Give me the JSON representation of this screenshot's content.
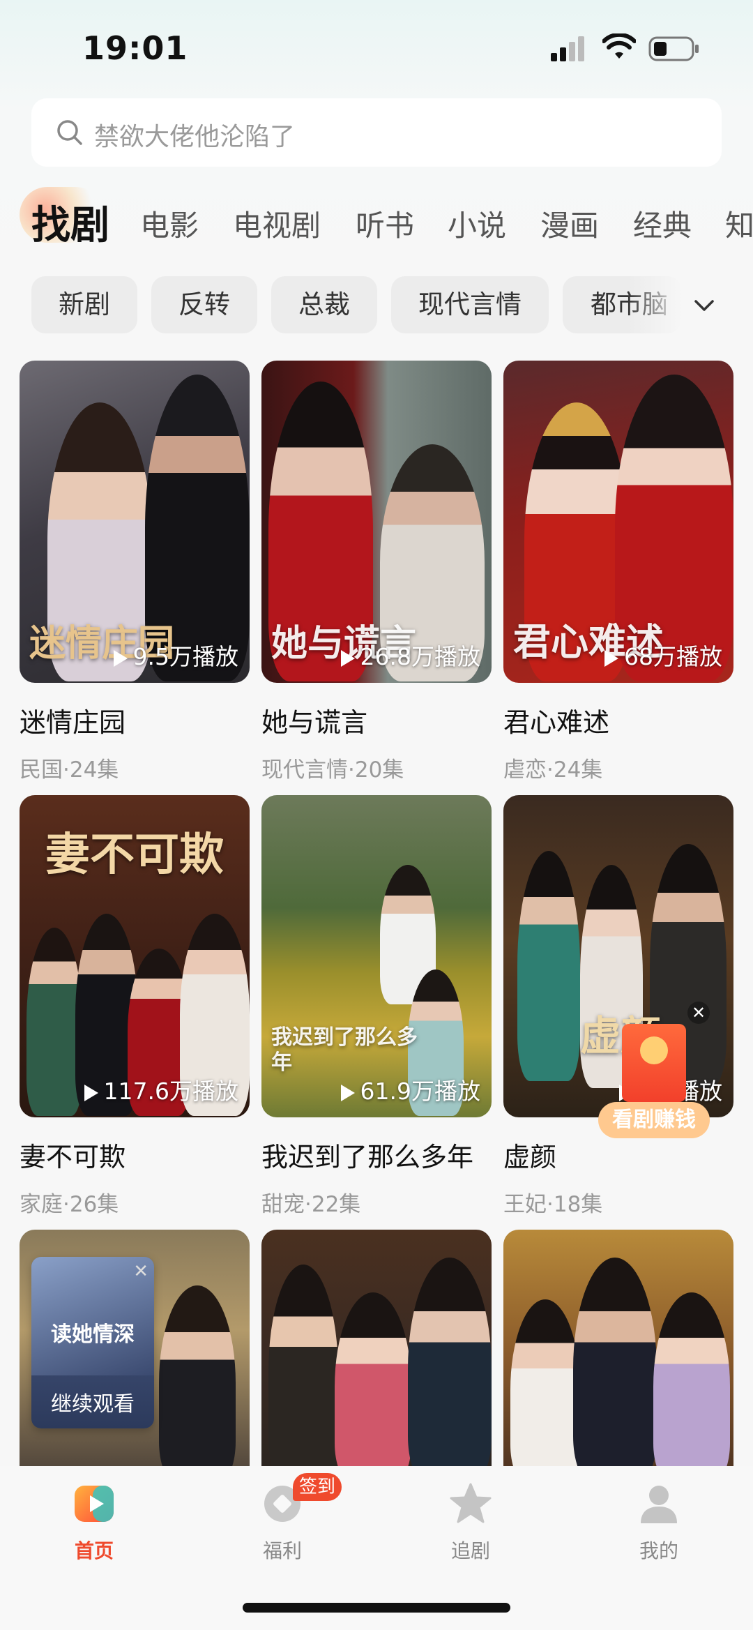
{
  "status_bar": {
    "time": "19:01"
  },
  "search": {
    "placeholder": "禁欲大佬他沦陷了"
  },
  "tabs": [
    "找剧",
    "电影",
    "电视剧",
    "听书",
    "小说",
    "漫画",
    "经典",
    "知"
  ],
  "chips": [
    "新剧",
    "反转",
    "总裁",
    "现代言情",
    "都市脑"
  ],
  "cards": [
    {
      "title": "迷情庄园",
      "meta": "民国·24集",
      "plays": "9.5万播放",
      "poster_text": "迷情庄园"
    },
    {
      "title": "她与谎言",
      "meta": "现代言情·20集",
      "plays": "26.8万播放",
      "poster_text": "她与谎言"
    },
    {
      "title": "君心难述",
      "meta": "虐恋·24集",
      "plays": "68万播放",
      "poster_text": "君心难述"
    },
    {
      "title": "妻不可欺",
      "meta": "家庭·26集",
      "plays": "117.6万播放",
      "poster_text": "妻不可欺"
    },
    {
      "title": "我迟到了那么多年",
      "meta": "甜宠·22集",
      "plays": "61.9万播放",
      "poster_text": "我迟到了那么多年"
    },
    {
      "title": "虚颜",
      "meta": "王妃·18集",
      "plays": "7万播放",
      "poster_text": "虚颜"
    }
  ],
  "continue_watching": {
    "label": "继续观看",
    "show": "读她情深",
    "close": "✕"
  },
  "promo": {
    "earn_label": "看剧赚钱",
    "close": "✕"
  },
  "bottom_nav": [
    {
      "label": "首页"
    },
    {
      "label": "福利",
      "badge": "签到"
    },
    {
      "label": "追剧"
    },
    {
      "label": "我的"
    }
  ],
  "colors": {
    "accent": "#ef4a2d",
    "earn": "#ffc98f"
  }
}
